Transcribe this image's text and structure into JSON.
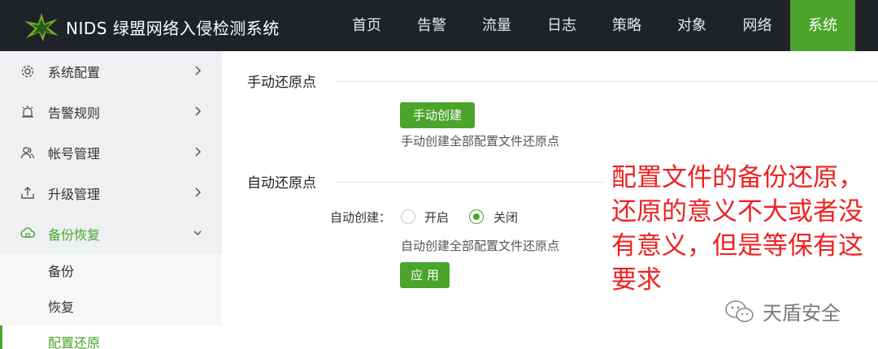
{
  "header": {
    "app_title": "NIDS 绿盟网络入侵检测系统",
    "nav": [
      {
        "label": "首页",
        "active": false
      },
      {
        "label": "告警",
        "active": false
      },
      {
        "label": "流量",
        "active": false
      },
      {
        "label": "日志",
        "active": false
      },
      {
        "label": "策略",
        "active": false
      },
      {
        "label": "对象",
        "active": false
      },
      {
        "label": "网络",
        "active": false
      },
      {
        "label": "系统",
        "active": true
      }
    ]
  },
  "sidebar": {
    "items": [
      {
        "label": "系统配置",
        "icon": "gear-icon"
      },
      {
        "label": "告警规则",
        "icon": "alarm-icon"
      },
      {
        "label": "帐号管理",
        "icon": "users-icon"
      },
      {
        "label": "升级管理",
        "icon": "upgrade-icon"
      },
      {
        "label": "备份恢复",
        "icon": "backup-icon",
        "open": true
      }
    ],
    "sub_items": [
      {
        "label": "备份"
      },
      {
        "label": "恢复"
      },
      {
        "label": "配置还原",
        "active": true
      }
    ]
  },
  "manual": {
    "title": "手动还原点",
    "button": "手动创建",
    "hint": "手动创建全部配置文件还原点"
  },
  "auto": {
    "title": "自动还原点",
    "field_label": "自动创建：",
    "option_on": "开启",
    "option_off": "关闭",
    "selected": "关闭",
    "hint": "自动创建全部配置文件还原点",
    "apply_button": "应 用"
  },
  "annotation": "配置文件的备份还原，还原的意义不大或者没有意义，但是等保有这要求",
  "watermark": "天盾安全",
  "colors": {
    "accent": "#4ba42b",
    "topbar": "#1f2328",
    "annotation": "#ee2222"
  }
}
